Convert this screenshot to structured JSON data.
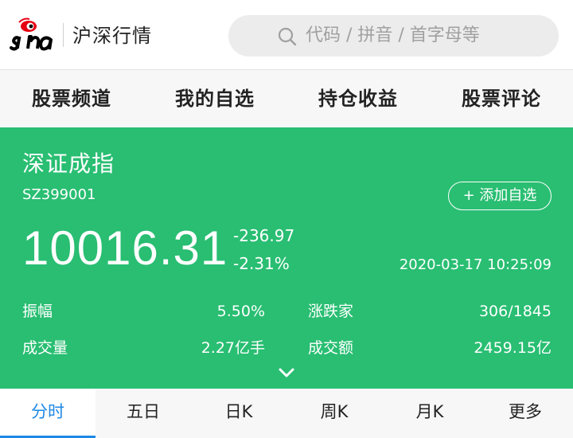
{
  "header": {
    "site_title": "沪深行情",
    "search_placeholder": "代码 / 拼音 / 首字母等"
  },
  "nav": [
    {
      "label": "股票频道"
    },
    {
      "label": "我的自选"
    },
    {
      "label": "持仓收益"
    },
    {
      "label": "股票评论"
    }
  ],
  "quote": {
    "name": "深证成指",
    "code": "SZ399001",
    "add_label": "+ 添加自选",
    "price": "10016.31",
    "change": "-236.97",
    "change_pct": "-2.31%",
    "timestamp": "2020-03-17 10:25:09",
    "stats": {
      "amplitude_label": "振幅",
      "amplitude_value": "5.50%",
      "updown_label": "涨跌家",
      "updown_value": "306/1845",
      "volume_label": "成交量",
      "volume_value": "2.27亿手",
      "turnover_label": "成交额",
      "turnover_value": "2459.15亿"
    }
  },
  "tabs": [
    {
      "label": "分时"
    },
    {
      "label": "五日"
    },
    {
      "label": "日K"
    },
    {
      "label": "周K"
    },
    {
      "label": "月K"
    },
    {
      "label": "更多"
    }
  ],
  "colors": {
    "quote_bg": "#29be72",
    "active_tab": "#1e88e5",
    "logo_red": "#e60012"
  },
  "icons": {
    "logo": "sina-logo",
    "search": "search-icon",
    "expand": "chevron-down-icon"
  }
}
